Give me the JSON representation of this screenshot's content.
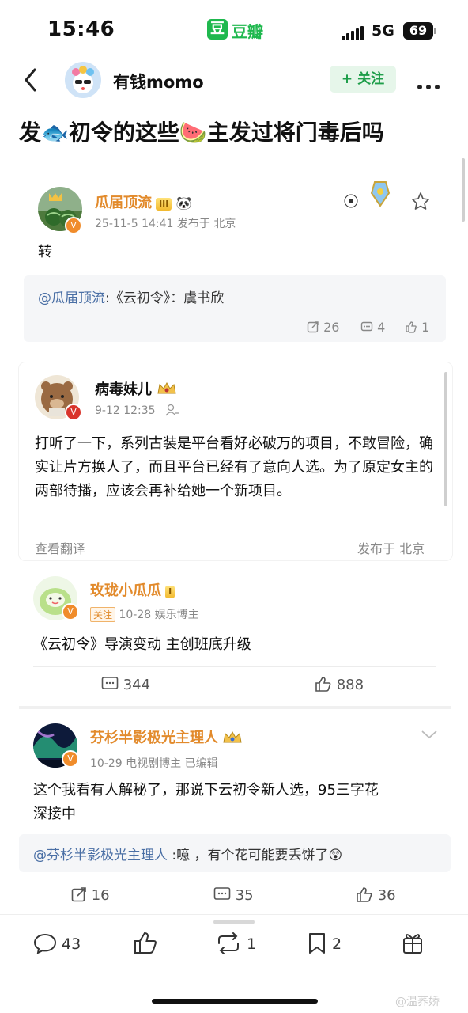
{
  "status_bar": {
    "time": "15:46",
    "app_badge": "豆",
    "app_name": "豆瓣",
    "network": "5G",
    "battery": "69"
  },
  "header": {
    "username": "有钱momo",
    "follow_label": "+ 关注"
  },
  "post": {
    "title": "发🐟初令的这些🍉主发过将门毒后吗"
  },
  "comment1": {
    "name": "瓜届顶流",
    "badge": "III",
    "emoji": "🐼",
    "meta": "25-11-5 14:41  发布于 北京",
    "text": "转",
    "quote_at": "@瓜届顶流",
    "quote_rest": ":《云初令》：虞书欣",
    "stats": {
      "repost": "26",
      "comment": "4",
      "like": "1"
    }
  },
  "comment2": {
    "name": "病毒妹儿",
    "meta": "9-12 12:35",
    "text": "打听了一下，系列古装是平台看好必破万的项目，不敢冒险，确实让片方换人了，而且平台已经有了意向人选。为了原定女主的两部待播，应该会再补给她一个新项目。",
    "translate": "查看翻译",
    "location": "发布于 北京"
  },
  "comment3": {
    "name": "玫珑小瓜瓜",
    "badge": "I",
    "follow_tag": "关注",
    "meta": "10-28  娱乐博主",
    "text": "《云初令》导演变动 主创班底升级",
    "stats": {
      "comment": "344",
      "like": "888"
    }
  },
  "comment4": {
    "name": "芬杉半影极光主理人",
    "meta": "10-29  电视剧博主  已编辑",
    "text_line1": "这个我看有人解秘了，那说下云初令新人选，95三字花",
    "text_line2": "深接中",
    "quote_at": "@芬杉半影极光主理人",
    "quote_rest": " :噫 ，有个花可能要丢饼了😲",
    "stats": {
      "repost": "16",
      "comment": "35",
      "like": "36"
    }
  },
  "bottom_bar": {
    "comments": "43",
    "reposts": "1",
    "collects": "2"
  },
  "watermark": "@温荞娇"
}
